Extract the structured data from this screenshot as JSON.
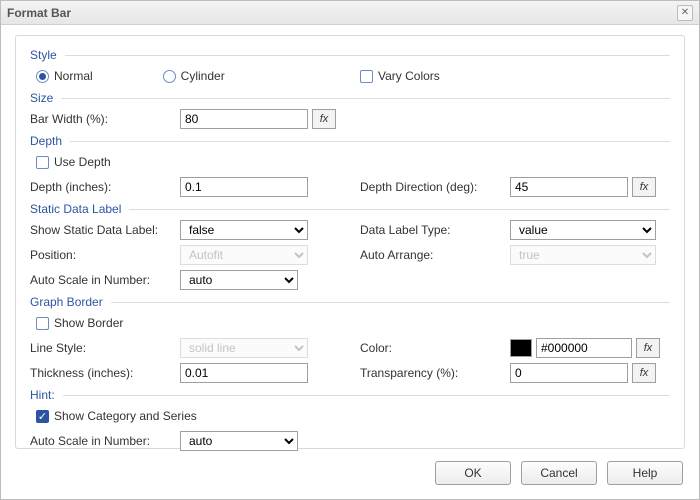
{
  "window": {
    "title": "Format Bar"
  },
  "style": {
    "heading": "Style",
    "normal": "Normal",
    "cylinder": "Cylinder",
    "vary_colors": "Vary Colors"
  },
  "size": {
    "heading": "Size",
    "bar_width_label": "Bar Width (%):",
    "bar_width_value": "80",
    "fx": "fx"
  },
  "depth": {
    "heading": "Depth",
    "use_depth": "Use Depth",
    "depth_label": "Depth (inches):",
    "depth_value": "0.1",
    "dir_label": "Depth Direction (deg):",
    "dir_value": "45",
    "fx": "fx"
  },
  "sdl": {
    "heading": "Static Data Label",
    "show_label": "Show Static Data Label:",
    "show_value": "false",
    "type_label": "Data Label Type:",
    "type_value": "value",
    "position_label": "Position:",
    "position_value": "Autofit",
    "auto_arrange_label": "Auto Arrange:",
    "auto_arrange_value": "true",
    "autoscale_label": "Auto Scale in Number:",
    "autoscale_value": "auto"
  },
  "border": {
    "heading": "Graph Border",
    "show_border": "Show Border",
    "line_style_label": "Line Style:",
    "line_style_value": "solid line",
    "color_label": "Color:",
    "color_value": "#000000",
    "thickness_label": "Thickness (inches):",
    "thickness_value": "0.01",
    "transparency_label": "Transparency (%):",
    "transparency_value": "0",
    "fx": "fx"
  },
  "hint": {
    "heading": "Hint:",
    "show_cat": "Show Category and Series",
    "autoscale_label": "Auto Scale in Number:",
    "autoscale_value": "auto"
  },
  "footer": {
    "ok": "OK",
    "cancel": "Cancel",
    "help": "Help"
  }
}
